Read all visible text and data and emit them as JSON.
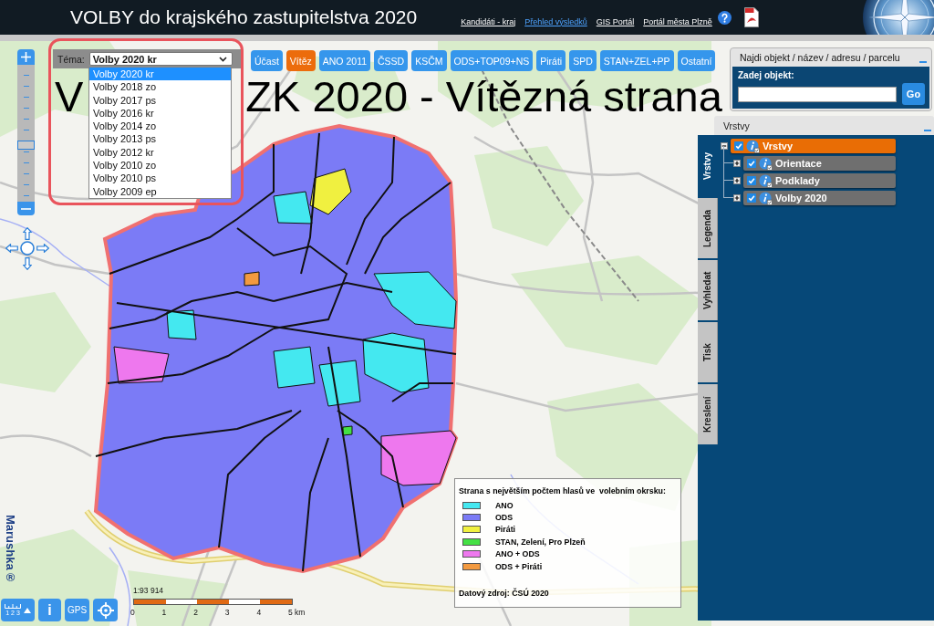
{
  "header": {
    "title": "VOLBY do krajského zastupitelstva 2020",
    "links": [
      {
        "label": "Kandidáti - kraj",
        "active": false
      },
      {
        "label": "Přehled výsledků",
        "active": true
      },
      {
        "label": "GIS Portál",
        "active": false
      },
      {
        "label": "Portál města Plzně",
        "active": false
      }
    ]
  },
  "theme_selector": {
    "label": "Téma:",
    "value": "Volby 2020 kr",
    "expanded": true,
    "options": [
      {
        "label": "Volby 2020 kr",
        "selected": true
      },
      {
        "label": "Volby 2018 zo",
        "selected": false
      },
      {
        "label": "Volby 2017 ps",
        "selected": false
      },
      {
        "label": "Volby 2016 kr",
        "selected": false
      },
      {
        "label": "Volby 2014 zo",
        "selected": false
      },
      {
        "label": "Volby 2013 ps",
        "selected": false
      },
      {
        "label": "Volby 2012 kr",
        "selected": false
      },
      {
        "label": "Volby 2010 zo",
        "selected": false
      },
      {
        "label": "Volby 2010 ps",
        "selected": false
      },
      {
        "label": "Volby 2009 ep",
        "selected": false
      }
    ]
  },
  "party_buttons": [
    {
      "label": "Účast",
      "selected": false
    },
    {
      "label": "Vítěz",
      "selected": true
    },
    {
      "label": "ANO 2011",
      "selected": false
    },
    {
      "label": "ČSSD",
      "selected": false
    },
    {
      "label": "KSČM",
      "selected": false
    },
    {
      "label": "ODS+TOP09+NS",
      "selected": false
    },
    {
      "label": "Piráti",
      "selected": false
    },
    {
      "label": "SPD",
      "selected": false
    },
    {
      "label": "STAN+ZEL+PP",
      "selected": false
    },
    {
      "label": "Ostatní",
      "selected": false
    }
  ],
  "map_title_fragments": [
    "V",
    "ZK 2020 - Vítězná strana"
  ],
  "search_panel": {
    "title": "Najdi objekt / název / adresu / parcelu",
    "field_label": "Zadej objekt:",
    "go_button": "Go"
  },
  "layers_panel": {
    "title": "Vrstvy",
    "tabs": [
      {
        "label": "Vrstvy",
        "selected": true
      },
      {
        "label": "Legenda",
        "selected": false
      },
      {
        "label": "Vyhledat",
        "selected": false
      },
      {
        "label": "Tisk",
        "selected": false
      },
      {
        "label": "Kreslení",
        "selected": false
      }
    ],
    "tree": [
      {
        "label": "Vrstvy",
        "checked": true,
        "expanded": true,
        "selected": true,
        "children": [
          {
            "label": "Orientace",
            "checked": true,
            "expanded": false,
            "selected": false
          },
          {
            "label": "Podklady",
            "checked": true,
            "expanded": false,
            "selected": false
          },
          {
            "label": "Volby 2020",
            "checked": true,
            "expanded": false,
            "selected": false
          }
        ]
      }
    ]
  },
  "zoom_slider": {
    "level": 0.41
  },
  "legend": {
    "title": "Strana s největším počtem hlasů ve  volebním okrsku:",
    "items": [
      {
        "label": "ANO",
        "color": "#44e8f0"
      },
      {
        "label": "ODS",
        "color": "#7b7bf6"
      },
      {
        "label": "Piráti",
        "color": "#f0f040"
      },
      {
        "label": "STAN, Zelení, Pro Plzeň",
        "color": "#44e044"
      },
      {
        "label": "ANO + ODS",
        "color": "#ee78ee"
      },
      {
        "label": "ODS + Piráti",
        "color": "#f39a40"
      }
    ],
    "source": "Datový zdroj: ČSÚ 2020"
  },
  "scale": {
    "ratio": "1:93 914",
    "labels": [
      "0",
      "1",
      "2",
      "3",
      "4",
      "5 km"
    ]
  },
  "toolbar": {
    "buttons": [
      {
        "kind": "scale",
        "label": "1 2 3"
      },
      {
        "kind": "info",
        "label": "i"
      },
      {
        "kind": "gps",
        "label": "GPS"
      },
      {
        "kind": "locate"
      }
    ]
  },
  "brand": "Marushka®"
}
